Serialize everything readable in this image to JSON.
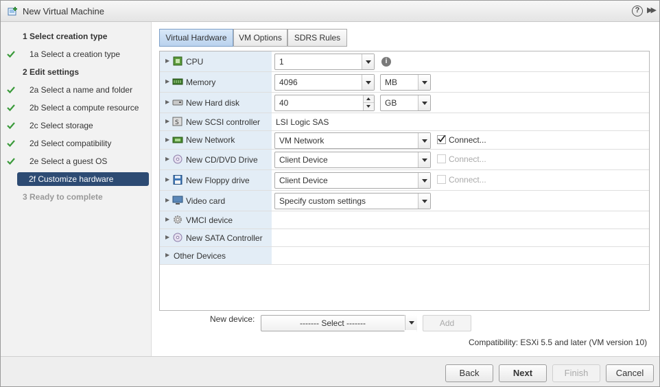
{
  "window": {
    "title": "New Virtual Machine",
    "help_glyph": "?",
    "expand_glyph": "▶▶"
  },
  "nav": {
    "items": [
      {
        "label": "1  Select creation type",
        "kind": "section"
      },
      {
        "label": "1a  Select a creation type",
        "done": true
      },
      {
        "label": "2  Edit settings",
        "kind": "section"
      },
      {
        "label": "2a  Select a name and folder",
        "done": true
      },
      {
        "label": "2b  Select a compute resource",
        "done": true
      },
      {
        "label": "2c  Select storage",
        "done": true
      },
      {
        "label": "2d  Select compatibility",
        "done": true
      },
      {
        "label": "2e  Select a guest OS",
        "done": true
      },
      {
        "label": "2f  Customize hardware",
        "active": true
      },
      {
        "label": "3  Ready to complete",
        "kind": "disabled"
      }
    ]
  },
  "tabs": [
    {
      "label": "Virtual Hardware",
      "active": true
    },
    {
      "label": "VM Options"
    },
    {
      "label": "SDRS Rules"
    }
  ],
  "hardware": {
    "cpu": {
      "label": "CPU",
      "value": "1",
      "icon": "cpu-icon"
    },
    "memory": {
      "label": "Memory",
      "value": "4096",
      "unit": "MB",
      "icon": "memory-icon"
    },
    "hard_disk": {
      "label": "New Hard disk",
      "value": "40",
      "unit": "GB",
      "icon": "hard-disk-icon"
    },
    "scsi": {
      "label": "New SCSI controller",
      "value": "LSI Logic SAS",
      "icon": "scsi-controller-icon"
    },
    "network": {
      "label": "New Network",
      "value": "VM Network",
      "connect": "Connect...",
      "connected": true,
      "icon": "network-card-icon"
    },
    "cdrom": {
      "label": "New CD/DVD Drive",
      "value": "Client Device",
      "connect": "Connect...",
      "connected": false,
      "icon": "cd-dvd-icon"
    },
    "floppy": {
      "label": "New Floppy drive",
      "value": "Client Device",
      "connect": "Connect...",
      "connected": false,
      "icon": "floppy-icon"
    },
    "video": {
      "label": "Video card",
      "value": "Specify custom settings",
      "icon": "video-card-icon"
    },
    "vmci": {
      "label": "VMCI device",
      "icon": "vmci-gear-icon"
    },
    "sata": {
      "label": "New SATA Controller",
      "icon": "sata-controller-icon"
    },
    "other": {
      "label": "Other Devices"
    }
  },
  "new_device": {
    "label": "New device:",
    "select_value": "------- Select -------",
    "add_label": "Add"
  },
  "compatibility": "Compatibility: ESXi 5.5 and later (VM version 10)",
  "footer": {
    "back": "Back",
    "next": "Next",
    "finish": "Finish",
    "cancel": "Cancel"
  },
  "colors": {
    "nav_active_bg": "#2d4b73",
    "check_green": "#3a9a3a",
    "label_col_bg": "#e3edf6"
  }
}
